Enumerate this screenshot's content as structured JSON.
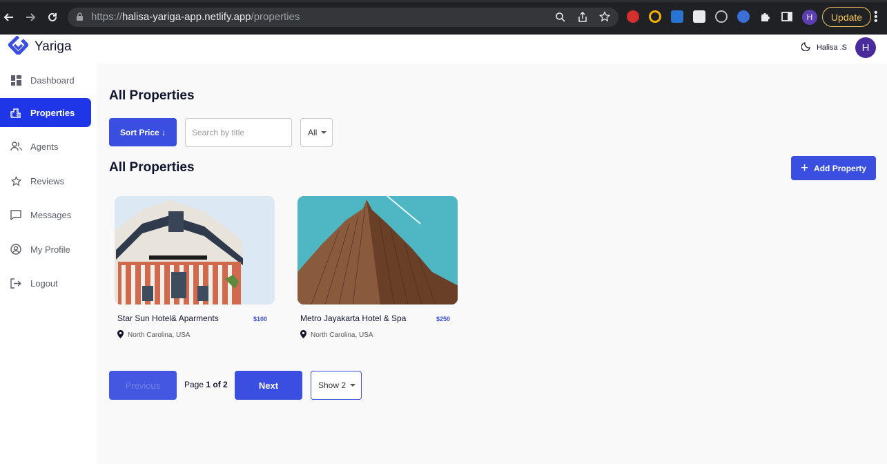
{
  "browser": {
    "url_scheme": "https://",
    "url_host": "halisa-yariga-app.netlify.app",
    "url_path": "/properties",
    "profile_initial": "H",
    "update_label": "Update"
  },
  "header": {
    "brand": "Yariga",
    "user_name": "Halisa .S",
    "avatar_initial": "H",
    "theme_icon": "moon-icon"
  },
  "sidebar": {
    "items": [
      {
        "label": "Dashboard",
        "icon": "dashboard-icon",
        "active": false
      },
      {
        "label": "Properties",
        "icon": "building-icon",
        "active": true
      },
      {
        "label": "Agents",
        "icon": "people-icon",
        "active": false
      },
      {
        "label": "Reviews",
        "icon": "star-icon",
        "active": false
      },
      {
        "label": "Messages",
        "icon": "chat-icon",
        "active": false
      },
      {
        "label": "My Profile",
        "icon": "user-circle-icon",
        "active": false
      },
      {
        "label": "Logout",
        "icon": "logout-icon",
        "active": false
      }
    ]
  },
  "main": {
    "title": "All Properties",
    "sort_label": "Sort Price ↓",
    "search_placeholder": "Search by title",
    "filter_value": "All",
    "list_title": "All Properties",
    "add_label": "Add Property",
    "properties": [
      {
        "title": "Star Sun Hotel& Aparments",
        "price": "$100",
        "location": "North Carolina, USA"
      },
      {
        "title": "Metro Jayakarta Hotel & Spa",
        "price": "$250",
        "location": "North Carolina, USA"
      }
    ],
    "pagination": {
      "prev_label": "Previous",
      "page_prefix": "Page",
      "page_current": "1 of 2",
      "next_label": "Next",
      "show_value": "Show 2"
    }
  },
  "colors": {
    "accent": "#3a4fe0",
    "sidebar_active": "#1e36e8",
    "text_dark": "#11142d"
  }
}
